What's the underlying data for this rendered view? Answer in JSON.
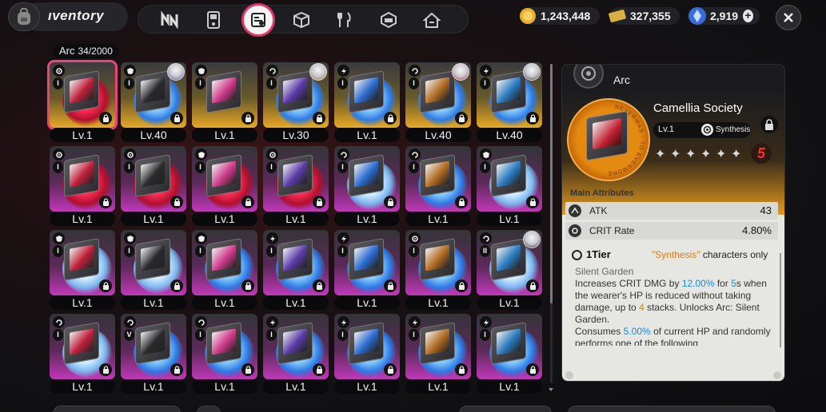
{
  "header": {
    "title": "ıventory",
    "tabs": [
      {
        "icon": "n-logo-icon"
      },
      {
        "icon": "device-icon"
      },
      {
        "icon": "arc-disk-icon",
        "active": true
      },
      {
        "icon": "cube-icon"
      },
      {
        "icon": "fork-knife-icon"
      },
      {
        "icon": "package-icon"
      },
      {
        "icon": "house-icon"
      }
    ],
    "currencies": [
      {
        "icon": "gold-coin-icon",
        "amount": "1,243,448"
      },
      {
        "icon": "ticket-icon",
        "amount": "327,355"
      },
      {
        "icon": "crystal-icon",
        "amount": "2,919",
        "plus": "+"
      }
    ],
    "close": "×"
  },
  "grid": {
    "section_label": "Arc",
    "count": "34/2000",
    "rows": [
      [
        {
          "level": "Lv.1",
          "rarity": "gold",
          "swirl": "red",
          "tier": "I",
          "type": "gear",
          "selected": true
        },
        {
          "level": "Lv.40",
          "rarity": "gold",
          "swirl": "blue",
          "tier": "I",
          "type": "shield",
          "avatar": true
        },
        {
          "level": "Lv.1",
          "rarity": "gold",
          "swirl": "none",
          "tier": "I",
          "type": "shield"
        },
        {
          "level": "Lv.30",
          "rarity": "gold",
          "swirl": "blue",
          "tier": "I",
          "type": "swirl",
          "avatar": true
        },
        {
          "level": "Lv.1",
          "rarity": "gold",
          "swirl": "blue",
          "tier": "I",
          "type": "bolt"
        },
        {
          "level": "Lv.40",
          "rarity": "gold",
          "swirl": "blue",
          "tier": "I",
          "type": "swirl",
          "avatar": true
        },
        {
          "level": "Lv.40",
          "rarity": "gold",
          "swirl": "blue",
          "tier": "I",
          "type": "bolt",
          "avatar": true
        }
      ],
      [
        {
          "level": "Lv.1",
          "rarity": "pink",
          "swirl": "red",
          "tier": "I",
          "type": "gear"
        },
        {
          "level": "Lv.1",
          "rarity": "pink",
          "swirl": "red",
          "tier": "I",
          "type": "gear"
        },
        {
          "level": "Lv.1",
          "rarity": "pink",
          "swirl": "red",
          "tier": "I",
          "type": "shield"
        },
        {
          "level": "Lv.1",
          "rarity": "pink",
          "swirl": "red",
          "tier": "I",
          "type": "gear"
        },
        {
          "level": "Lv.1",
          "rarity": "pink",
          "swirl": "white",
          "tier": "I",
          "type": "swirl"
        },
        {
          "level": "Lv.1",
          "rarity": "pink",
          "swirl": "blue",
          "tier": "I",
          "type": "swirl"
        },
        {
          "level": "Lv.1",
          "rarity": "pink",
          "swirl": "white",
          "tier": "I",
          "type": "shield"
        }
      ],
      [
        {
          "level": "Lv.1",
          "rarity": "pink",
          "swirl": "white",
          "tier": "I",
          "type": "shield"
        },
        {
          "level": "Lv.1",
          "rarity": "pink",
          "swirl": "white",
          "tier": "I",
          "type": "shield"
        },
        {
          "level": "Lv.1",
          "rarity": "pink",
          "swirl": "blue",
          "tier": "I",
          "type": "shield"
        },
        {
          "level": "Lv.1",
          "rarity": "pink",
          "swirl": "blue",
          "tier": "I",
          "type": "bolt"
        },
        {
          "level": "Lv.1",
          "rarity": "pink",
          "swirl": "blue",
          "tier": "I",
          "type": "bolt"
        },
        {
          "level": "Lv.1",
          "rarity": "pink",
          "swirl": "blue",
          "tier": "I",
          "type": "gear"
        },
        {
          "level": "Lv.1",
          "rarity": "pink",
          "swirl": "white",
          "tier": "II",
          "type": "swirl",
          "avatar": true
        }
      ],
      [
        {
          "level": "Lv.1",
          "rarity": "pink",
          "swirl": "white",
          "tier": "I",
          "type": "swirl"
        },
        {
          "level": "Lv.1",
          "rarity": "pink",
          "swirl": "blue",
          "tier": "V",
          "type": "swirl"
        },
        {
          "level": "Lv.1",
          "rarity": "pink",
          "swirl": "blue",
          "tier": "I",
          "type": "swirl"
        },
        {
          "level": "Lv.1",
          "rarity": "pink",
          "swirl": "blue",
          "tier": "I",
          "type": "bolt"
        },
        {
          "level": "Lv.1",
          "rarity": "pink",
          "swirl": "blue",
          "tier": "I",
          "type": "bolt"
        },
        {
          "level": "Lv.1",
          "rarity": "pink",
          "swirl": "blue",
          "tier": "I",
          "type": "bolt"
        },
        {
          "level": "Lv.1",
          "rarity": "pink",
          "swirl": "blue",
          "tier": "I",
          "type": "bolt"
        }
      ]
    ]
  },
  "detail": {
    "header": "Arc",
    "ring_text": "NEVERWAS · TO EVERMORE",
    "name": "Camellia Society",
    "level": "Lv.1",
    "affinity": "Synthesis",
    "stars": 6,
    "tier_badge": "5",
    "main_attributes_label": "Main Attributes",
    "attributes": [
      {
        "icon": "atk-icon",
        "name": "ATK",
        "value": "43"
      },
      {
        "icon": "crit-icon",
        "name": "CRIT Rate",
        "value": "4.80%"
      }
    ],
    "tier_label": "1Tier",
    "tier_condition_quote": "\"Synthesis\"",
    "tier_condition_rest": " characters only",
    "effect_name": "Silent Garden",
    "desc_1": "Increases CRIT DMG by ",
    "desc_1_val": "12.00%",
    "desc_2": " for ",
    "desc_2_val": "5",
    "desc_3": "s when the wearer's HP is reduced without taking damage, up to ",
    "desc_3_val": "4",
    "desc_4": " stacks. Unlocks Arc: Silent Garden.",
    "desc_5": "Consumes ",
    "desc_5_val": "5.00%",
    "desc_6": " of current HP and randomly performs one of the following"
  },
  "colors": {
    "selected_outline": "#e8467a",
    "gold_rarity": "#e7a826",
    "pink_rarity": "#c038b8",
    "highlight_blue": "#1a8ad6",
    "highlight_orange": "#e07a14"
  }
}
